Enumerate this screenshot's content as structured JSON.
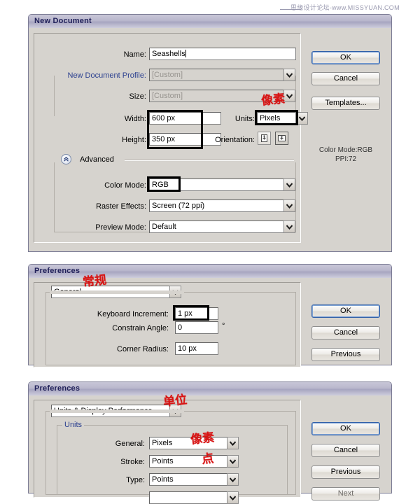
{
  "watermark": {
    "text": "思缘设计论坛-www.MISSYUAN.COM"
  },
  "new_document": {
    "title": "New Document",
    "fields": {
      "name_label": "Name:",
      "name_value": "Seashells",
      "profile_label": "New Document Profile:",
      "profile_value": "[Custom]",
      "size_label": "Size:",
      "size_value": "[Custom]",
      "width_label": "Width:",
      "width_value": "600 px",
      "height_label": "Height:",
      "height_value": "350 px",
      "units_label": "Units:",
      "units_value": "Pixels",
      "orientation_label": "Orientation:",
      "advanced_label": "Advanced",
      "color_mode_label": "Color Mode:",
      "color_mode_value": "RGB",
      "raster_effects_label": "Raster Effects:",
      "raster_effects_value": "Screen (72 ppi)",
      "preview_mode_label": "Preview Mode:",
      "preview_mode_value": "Default"
    },
    "buttons": {
      "ok": "OK",
      "cancel": "Cancel",
      "templates": "Templates..."
    },
    "summary": {
      "color_mode": "Color Mode:RGB",
      "ppi": "PPI:72"
    },
    "annotation_pixels": "像素"
  },
  "preferences_general": {
    "title": "Preferences",
    "section_value": "General",
    "fields": {
      "keyboard_increment_label": "Keyboard Increment:",
      "keyboard_increment_value": "1 px",
      "constrain_angle_label": "Constrain Angle:",
      "constrain_angle_value": "0",
      "degree_symbol": "°",
      "corner_radius_label": "Corner Radius:",
      "corner_radius_value": "10 px"
    },
    "buttons": {
      "ok": "OK",
      "cancel": "Cancel",
      "previous": "Previous"
    },
    "annotation_general": "常规"
  },
  "preferences_units": {
    "title": "Preferences",
    "section_value": "Units & Display Performance",
    "group_title": "Units",
    "fields": {
      "general_label": "General:",
      "general_value": "Pixels",
      "stroke_label": "Stroke:",
      "stroke_value": "Points",
      "type_label": "Type:",
      "type_value": "Points"
    },
    "buttons": {
      "ok": "OK",
      "cancel": "Cancel",
      "previous": "Previous",
      "next": "Next"
    },
    "annotation_units": "单位",
    "annotation_pixels": "像素",
    "annotation_points": "点"
  },
  "colors": {
    "dialog_face": "#d6d3ce",
    "titlebar": "#b9b7cc",
    "title_text": "#21215a",
    "accent_blue": "#2a3f8f",
    "annotation_red": "#d81414",
    "default_button_border": "#2f5fa8"
  }
}
